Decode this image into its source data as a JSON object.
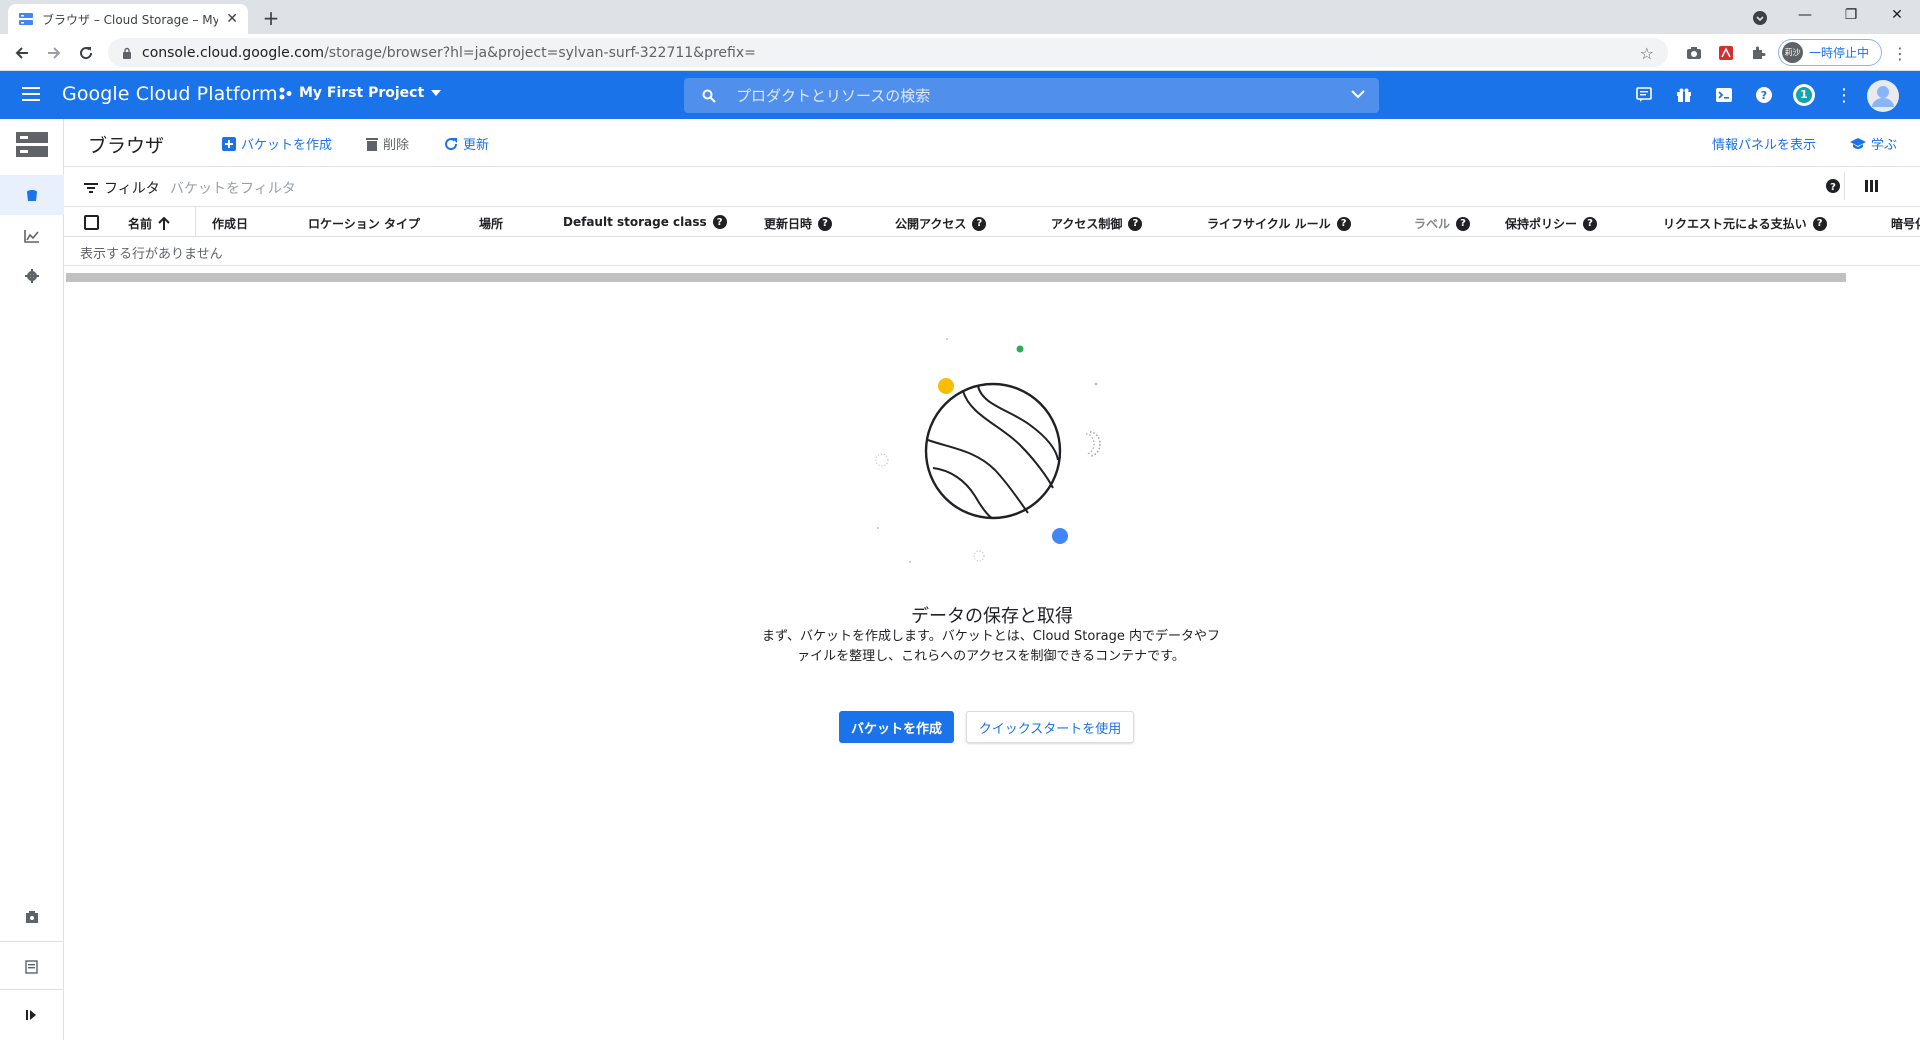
{
  "browser": {
    "tab_title": "ブラウザ – Cloud Storage – My Firs",
    "url_host": "console.cloud.google.com",
    "url_rest": "/storage/browser?hl=ja&project=sylvan-surf-322711&prefix=",
    "profile_avatar": "莉沙",
    "profile_status": "一時停止中"
  },
  "header": {
    "brand": "Google Cloud Platform",
    "project": "My First Project",
    "search_placeholder": "プロダクトとリソースの検索",
    "notification_count": "1"
  },
  "toolbar": {
    "title": "ブラウザ",
    "create_bucket": "バケットを作成",
    "delete": "削除",
    "refresh": "更新",
    "show_info_panel": "情報パネルを表示",
    "learn": "学ぶ"
  },
  "filter": {
    "label": "フィルタ",
    "placeholder": "バケットをフィルタ"
  },
  "table": {
    "columns": [
      "名前",
      "作成日",
      "ロケーション タイプ",
      "場所",
      "Default storage class",
      "更新日時",
      "公開アクセス",
      "アクセス制御",
      "ライフサイクル ルール",
      "ラベル",
      "保持ポリシー",
      "リクエスト元による支払い",
      "暗号化"
    ],
    "empty_text": "表示する行がありません"
  },
  "empty_state": {
    "title": "データの保存と取得",
    "description": "まず、バケットを作成します。バケットとは、Cloud Storage 内でデータやファイルを整理し、これらへのアクセスを制御できるコンテナです。",
    "create_button": "バケットを作成",
    "quickstart_button": "クイックスタートを使用"
  },
  "colors": {
    "brand_blue": "#1a73e8",
    "dot_yellow": "#fbbc04",
    "dot_red": "#ea4335",
    "dot_green": "#34a853"
  }
}
